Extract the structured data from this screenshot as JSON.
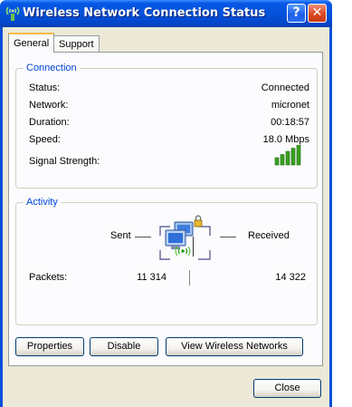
{
  "window": {
    "title": "Wireless Network Connection Status",
    "help_glyph": "?",
    "close_glyph": "✕"
  },
  "tabs": [
    {
      "label": "General",
      "selected": true
    },
    {
      "label": "Support",
      "selected": false
    }
  ],
  "connection": {
    "group_label": "Connection",
    "rows": [
      {
        "label": "Status:",
        "value": "Connected"
      },
      {
        "label": "Network:",
        "value": "micronet"
      },
      {
        "label": "Duration:",
        "value": "00:18:57"
      },
      {
        "label": "Speed:",
        "value": "18.0 Mbps"
      }
    ],
    "signal_label": "Signal Strength:",
    "signal_bars_lit": 5,
    "signal_bars_total": 5
  },
  "activity": {
    "group_label": "Activity",
    "sent_label": "Sent",
    "received_label": "Received",
    "packets_label": "Packets:",
    "packets_sent": "11 314",
    "packets_received": "14 322"
  },
  "buttons": {
    "properties": "Properties",
    "disable": "Disable",
    "view_networks": "View Wireless Networks",
    "close": "Close"
  },
  "colors": {
    "titlebar": "#0452da",
    "group_label": "#0046d5",
    "signal_green": "#3aa020",
    "dialog_bg": "#ece9d8"
  }
}
